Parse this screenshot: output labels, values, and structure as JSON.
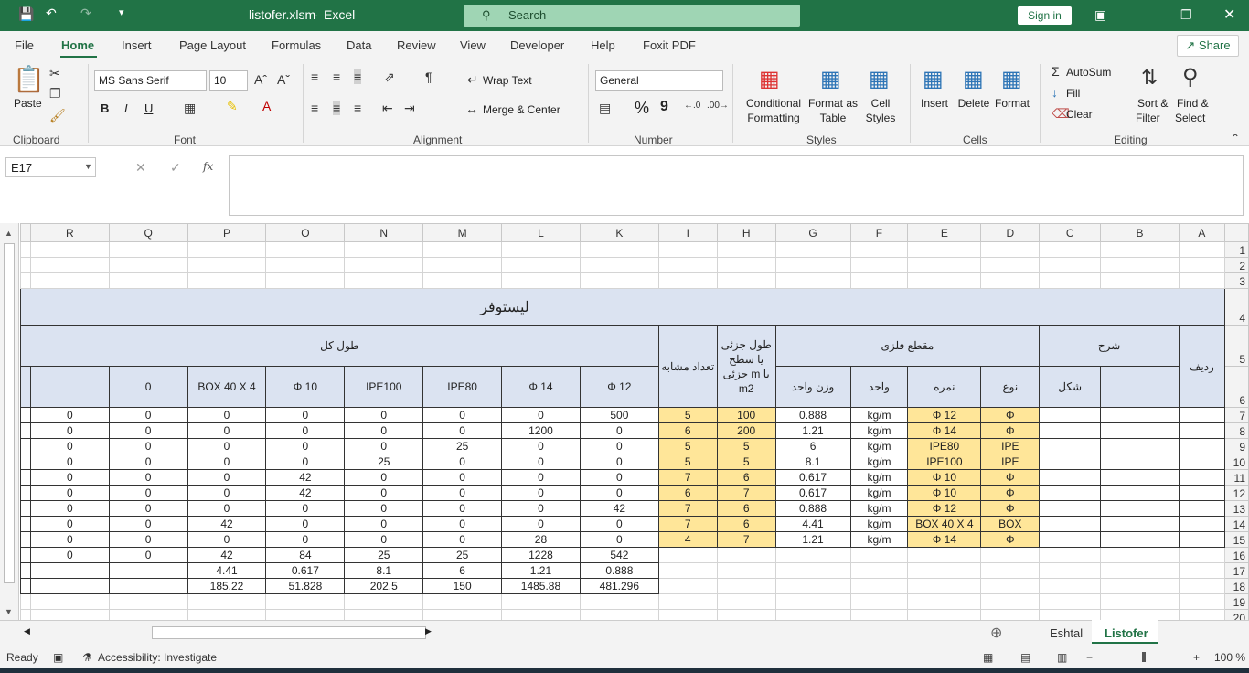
{
  "title": {
    "filename": "listofer.xlsm",
    "app": "Excel",
    "search": "Search",
    "signin": "Sign in"
  },
  "menu": {
    "file": "File",
    "home": "Home",
    "insert": "Insert",
    "page_layout": "Page Layout",
    "formulas": "Formulas",
    "data": "Data",
    "review": "Review",
    "view": "View",
    "developer": "Developer",
    "help": "Help",
    "foxit": "Foxit PDF",
    "share": "Share"
  },
  "ribbon": {
    "paste": "Paste",
    "clipboard": "Clipboard",
    "font_name": "MS Sans Serif",
    "font_size": "10",
    "font_group": "Font",
    "bold": "B",
    "italic": "I",
    "underline": "U",
    "wrap_text": "Wrap Text",
    "merge_center": "Merge & Center",
    "alignment": "Alignment",
    "number_format": "General",
    "number_group": "Number",
    "percent": "%",
    "comma": "9",
    "cond_format": "Conditional",
    "cond_format2": "Formatting",
    "format_table": "Format as",
    "format_table2": "Table",
    "cell_styles": "Cell",
    "cell_styles2": "Styles",
    "styles": "Styles",
    "insert": "Insert",
    "delete": "Delete",
    "format": "Format",
    "cells": "Cells",
    "autosum": "AutoSum",
    "fill": "Fill",
    "clear": "Clear",
    "sort_filter": "Sort &",
    "sort_filter2": "Filter",
    "find_select": "Find &",
    "find_select2": "Select",
    "editing": "Editing"
  },
  "formula_bar": {
    "name_box": "E17",
    "fx": "fx",
    "formula": ""
  },
  "columns": [
    "R",
    "Q",
    "P",
    "O",
    "N",
    "M",
    "L",
    "K",
    "I",
    "H",
    "G",
    "F",
    "E",
    "D",
    "C",
    "B",
    "A"
  ],
  "sheet": {
    "title": "لیستوفر",
    "hdr_total_length": "طول کل",
    "hdr_count": "تعداد مشابه",
    "hdr_partial": "طول جزئی یا سطح جزئی m یا m2",
    "hdr_section": "مقطع فلزی",
    "hdr_desc": "شرح",
    "hdr_row": "ردیف",
    "hdr_unit_weight": "وزن واحد",
    "hdr_unit": "واحد",
    "hdr_size": "نمره",
    "hdr_type": "نوع",
    "hdr_shape": "شکل",
    "size_cols": [
      "",
      "0",
      "BOX 40 X 4",
      "Φ 10",
      "IPE100",
      "IPE80",
      "Φ 14",
      "Φ 12"
    ],
    "rows": [
      {
        "r": "0",
        "q": "0",
        "p": "0",
        "o": "0",
        "n": "0",
        "m": "0",
        "l": "0",
        "k": "500",
        "i": "5",
        "h": "100",
        "g": "0.888",
        "f": "kg/m",
        "e": "Φ 12",
        "d": "Φ"
      },
      {
        "r": "0",
        "q": "0",
        "p": "0",
        "o": "0",
        "n": "0",
        "m": "0",
        "l": "1200",
        "k": "0",
        "i": "6",
        "h": "200",
        "g": "1.21",
        "f": "kg/m",
        "e": "Φ 14",
        "d": "Φ"
      },
      {
        "r": "0",
        "q": "0",
        "p": "0",
        "o": "0",
        "n": "0",
        "m": "25",
        "l": "0",
        "k": "0",
        "i": "5",
        "h": "5",
        "g": "6",
        "f": "kg/m",
        "e": "IPE80",
        "d": "IPE"
      },
      {
        "r": "0",
        "q": "0",
        "p": "0",
        "o": "0",
        "n": "25",
        "m": "0",
        "l": "0",
        "k": "0",
        "i": "5",
        "h": "5",
        "g": "8.1",
        "f": "kg/m",
        "e": "IPE100",
        "d": "IPE"
      },
      {
        "r": "0",
        "q": "0",
        "p": "0",
        "o": "42",
        "n": "0",
        "m": "0",
        "l": "0",
        "k": "0",
        "i": "7",
        "h": "6",
        "g": "0.617",
        "f": "kg/m",
        "e": "Φ 10",
        "d": "Φ"
      },
      {
        "r": "0",
        "q": "0",
        "p": "0",
        "o": "42",
        "n": "0",
        "m": "0",
        "l": "0",
        "k": "0",
        "i": "6",
        "h": "7",
        "g": "0.617",
        "f": "kg/m",
        "e": "Φ 10",
        "d": "Φ"
      },
      {
        "r": "0",
        "q": "0",
        "p": "0",
        "o": "0",
        "n": "0",
        "m": "0",
        "l": "0",
        "k": "42",
        "i": "7",
        "h": "6",
        "g": "0.888",
        "f": "kg/m",
        "e": "Φ 12",
        "d": "Φ"
      },
      {
        "r": "0",
        "q": "0",
        "p": "42",
        "o": "0",
        "n": "0",
        "m": "0",
        "l": "0",
        "k": "0",
        "i": "7",
        "h": "6",
        "g": "4.41",
        "f": "kg/m",
        "e": "BOX 40 X 4",
        "d": "BOX"
      },
      {
        "r": "0",
        "q": "0",
        "p": "0",
        "o": "0",
        "n": "0",
        "m": "0",
        "l": "28",
        "k": "0",
        "i": "4",
        "h": "7",
        "g": "1.21",
        "f": "kg/m",
        "e": "Φ 14",
        "d": "Φ"
      }
    ],
    "totals": [
      "0",
      "0",
      "42",
      "84",
      "25",
      "25",
      "1228",
      "542"
    ],
    "unit_weights": [
      "4.41",
      "0.617",
      "8.1",
      "6",
      "1.21",
      "0.888"
    ],
    "weights": [
      "185.22",
      "51.828",
      "202.5",
      "150",
      "1485.88",
      "481.296"
    ]
  },
  "tabs": {
    "tab1": "Eshtal",
    "tab2": "Listofer"
  },
  "status": {
    "ready": "Ready",
    "accessibility": "Accessibility: Investigate",
    "zoom": "100 %"
  }
}
